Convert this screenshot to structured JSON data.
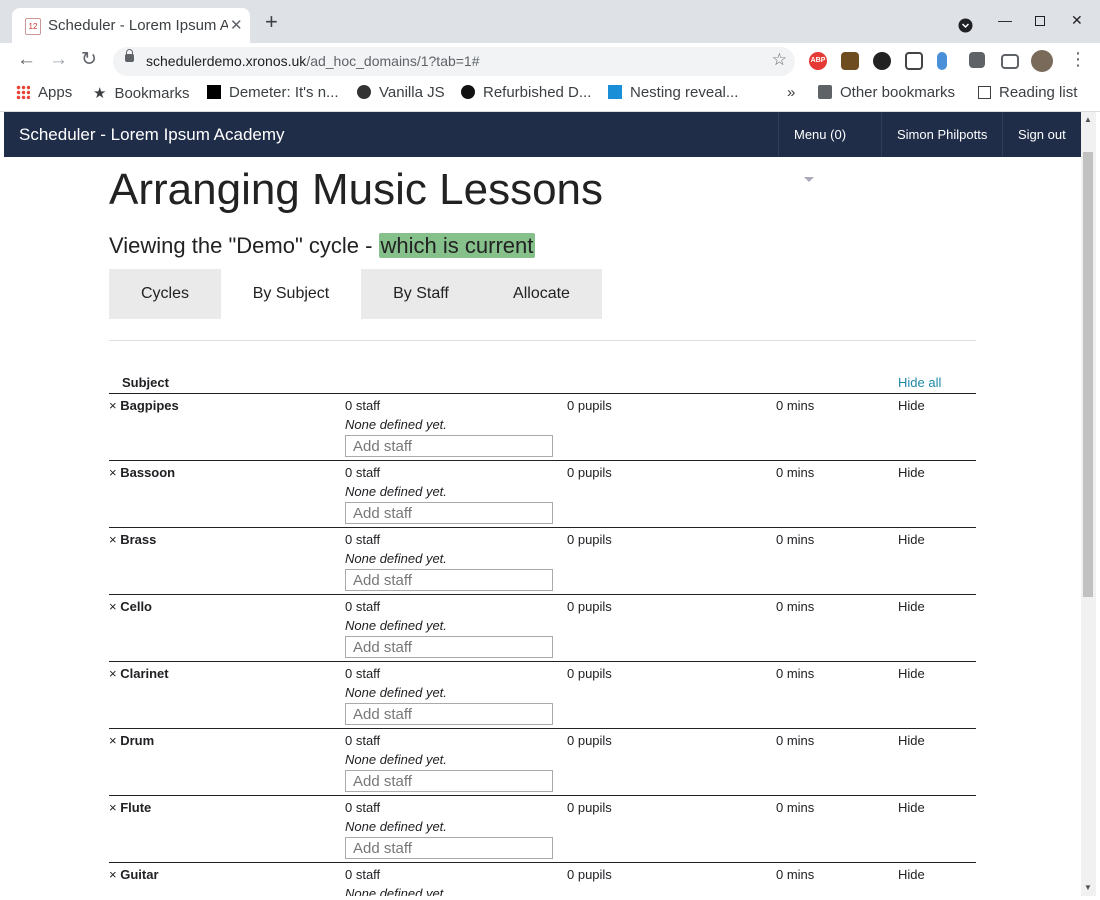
{
  "browser": {
    "tab_title": "Scheduler - Lorem Ipsum Academy",
    "tab_favicon_text": "12",
    "url_host": "schedulerdemo.xronos.uk",
    "url_path": "/ad_hoc_domains/1?tab=1#",
    "bookmarks": [
      {
        "label": "Apps",
        "icon": "apps-grid-icon"
      },
      {
        "label": "Bookmarks",
        "icon": "star-icon"
      },
      {
        "label": "Demeter: It's n...",
        "icon": "black-square-icon"
      },
      {
        "label": "Vanilla JS",
        "icon": "globe-icon"
      },
      {
        "label": "Refurbished D...",
        "icon": "info-circle-icon"
      },
      {
        "label": "Nesting reveal...",
        "icon": "f-logo-icon"
      }
    ],
    "bookmarks_overflow": "»",
    "other_bookmarks": "Other bookmarks",
    "reading_list": "Reading list"
  },
  "app": {
    "brand": "Scheduler - Lorem Ipsum Academy",
    "menu_label": "Menu (0)",
    "user_name": "Simon Philpotts",
    "sign_out": "Sign out"
  },
  "page": {
    "title": "Arranging Music Lessons",
    "subtitle_prefix": "Viewing the \"Demo\" cycle - ",
    "subtitle_highlight": "which is current",
    "tabs": [
      "Cycles",
      "By Subject",
      "By Staff",
      "Allocate"
    ],
    "active_tab": "By Subject"
  },
  "table": {
    "header_subject": "Subject",
    "hide_all": "Hide all",
    "none_defined": "None defined yet.",
    "add_staff_placeholder": "Add staff",
    "hide_label": "Hide",
    "remove_glyph": "×",
    "rows": [
      {
        "subject": "Bagpipes",
        "staff": "0 staff",
        "pupils": "0 pupils",
        "mins": "0 mins"
      },
      {
        "subject": "Bassoon",
        "staff": "0 staff",
        "pupils": "0 pupils",
        "mins": "0 mins"
      },
      {
        "subject": "Brass",
        "staff": "0 staff",
        "pupils": "0 pupils",
        "mins": "0 mins"
      },
      {
        "subject": "Cello",
        "staff": "0 staff",
        "pupils": "0 pupils",
        "mins": "0 mins"
      },
      {
        "subject": "Clarinet",
        "staff": "0 staff",
        "pupils": "0 pupils",
        "mins": "0 mins"
      },
      {
        "subject": "Drum",
        "staff": "0 staff",
        "pupils": "0 pupils",
        "mins": "0 mins"
      },
      {
        "subject": "Flute",
        "staff": "0 staff",
        "pupils": "0 pupils",
        "mins": "0 mins"
      },
      {
        "subject": "Guitar",
        "staff": "0 staff",
        "pupils": "0 pupils",
        "mins": "0 mins"
      }
    ]
  },
  "colors": {
    "navbar": "#1f2d49",
    "highlight": "#86c08b",
    "link": "#2089a6"
  }
}
